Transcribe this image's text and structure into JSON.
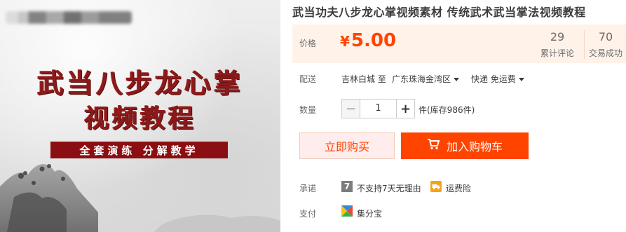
{
  "image": {
    "title_line1": "武当八步龙心掌",
    "title_line2": "视频教程",
    "banner": "全套演练  分解教学"
  },
  "product": {
    "title": "武当功夫八步龙心掌视频素材 传统武术武当掌法视频教程"
  },
  "price": {
    "label": "价格",
    "currency": "¥",
    "value": "5.00",
    "reviews_count": "29",
    "reviews_label": "累计评论",
    "deals_count": "70",
    "deals_label": "交易成功"
  },
  "shipping": {
    "label": "配送",
    "from": "吉林白城 至",
    "to": "广东珠海金湾区",
    "method": "快递 免运费"
  },
  "quantity": {
    "label": "数量",
    "value": "1",
    "minus": "−",
    "plus": "+",
    "stock": "件(库存986件)"
  },
  "actions": {
    "buy_now": "立即购买",
    "add_to_cart": "加入购物车"
  },
  "promise": {
    "label": "承诺",
    "no_reason_badge": "7",
    "no_reason_text": "不支持7天无理由",
    "shipping_insurance_text": "运费险"
  },
  "payment": {
    "label": "支付",
    "method": "集分宝"
  },
  "colors": {
    "accent": "#ff4400",
    "price_bg": "#fff2e8",
    "image_title": "#8b1a1a",
    "banner_bg": "#8b0f12"
  }
}
